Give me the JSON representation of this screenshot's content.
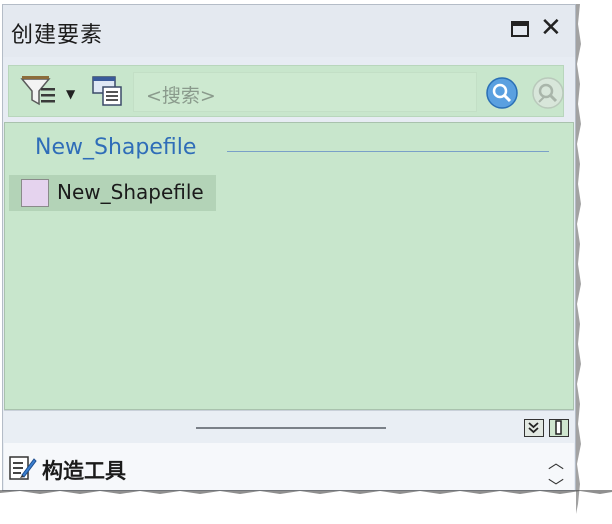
{
  "window": {
    "title": "创建要素",
    "maximize_icon": "maximize-icon",
    "close_label": "✕"
  },
  "toolbar": {
    "filter_icon": "filter-icon",
    "view_icon": "list-view-icon",
    "search_placeholder": "<搜索>",
    "search_icon": "search-icon",
    "clear_search_icon": "clear-search-icon"
  },
  "templates": {
    "group_name": "New_Shapefile",
    "items": [
      {
        "label": "New_Shapefile",
        "swatch_color": "#e5d3ee"
      }
    ]
  },
  "construction_tools": {
    "label": "构造工具"
  },
  "colors": {
    "content_bg": "#c8e6cc",
    "group_header": "#2f6db8"
  }
}
